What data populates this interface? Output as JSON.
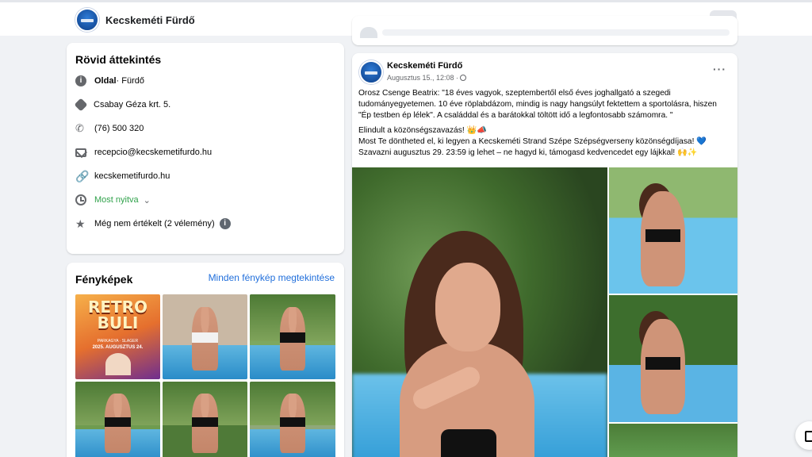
{
  "header": {
    "page_name": "Kecskeméti Fürdő",
    "more_label": "···"
  },
  "intro": {
    "title": "Rövid áttekintés",
    "category_label": "Oldal",
    "category_value": " · Fürdő",
    "address": "Csabay Géza krt. 5.",
    "phone": "(76) 500 320",
    "email": "recepcio@kecskemetifurdo.hu",
    "website": "kecskemetifurdo.hu",
    "hours": "Most nyitva",
    "hours_chevron": "⌄",
    "rating": "Még nem értékelt (2 vélemény)",
    "info_glyph": "i"
  },
  "photos": {
    "title": "Fényképek",
    "see_all": "Minden fénykép megtekintése",
    "retro_title1": "RETRO",
    "retro_title2": "BULI",
    "retro_sub": "PARKAGYA · SLAGER",
    "retro_date": "2025. AUGUSZTUS 24."
  },
  "post": {
    "author": "Kecskeméti Fürdő",
    "date": "Augusztus 15., 12:08 ·",
    "more_label": "···",
    "p1": "Orosz Csenge Beatrix: \"18 éves vagyok, szeptembertől első éves joghallgató a szegedi tudományegyetemen. 10 éve röplabdázom, mindig is nagy hangsúlyt fektettem a sportolásra, hiszen \"Ép testben ép lélek\". A családdal és a barátokkal töltött idő a legfontosabb számomra. \"",
    "p2": "Elindult a közönségszavazás! 👑📣",
    "p3": "Most Te döntheted el, ki legyen a Kecskeméti Strand Szépe Szépségverseny közönségdíjasa! 💙",
    "p4": "Szavazni augusztus 29. 23:59 ig lehet – ne hagyd ki, támogasd kedvencedet egy lájkkal! 🙌✨"
  },
  "icons": {
    "phone": "✆",
    "link": "🔗",
    "star": "★"
  },
  "colors": {
    "link_blue": "#216fdb",
    "open_green": "#31a24c",
    "background": "#f0f2f5"
  }
}
